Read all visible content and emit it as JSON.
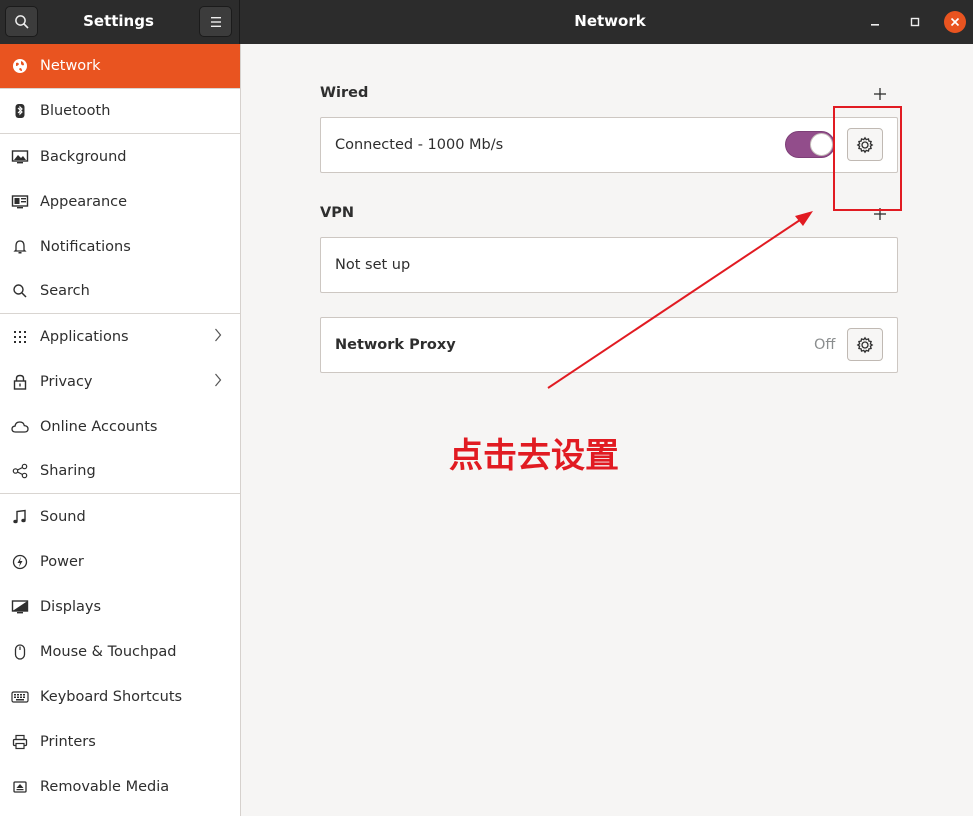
{
  "header": {
    "settings_title": "Settings",
    "page_title": "Network"
  },
  "sidebar": {
    "items": [
      {
        "label": "Network",
        "icon": "network-globe-icon"
      },
      {
        "label": "Bluetooth",
        "icon": "bluetooth-icon"
      },
      {
        "label": "Background",
        "icon": "background-monitor-icon"
      },
      {
        "label": "Appearance",
        "icon": "appearance-icon"
      },
      {
        "label": "Notifications",
        "icon": "bell-icon"
      },
      {
        "label": "Search",
        "icon": "search-icon"
      },
      {
        "label": "Applications",
        "icon": "grid-icon"
      },
      {
        "label": "Privacy",
        "icon": "lock-icon"
      },
      {
        "label": "Online Accounts",
        "icon": "cloud-icon"
      },
      {
        "label": "Sharing",
        "icon": "share-icon"
      },
      {
        "label": "Sound",
        "icon": "music-note-icon"
      },
      {
        "label": "Power",
        "icon": "power-icon"
      },
      {
        "label": "Displays",
        "icon": "display-icon"
      },
      {
        "label": "Mouse & Touchpad",
        "icon": "mouse-icon"
      },
      {
        "label": "Keyboard Shortcuts",
        "icon": "keyboard-icon"
      },
      {
        "label": "Printers",
        "icon": "printer-icon"
      },
      {
        "label": "Removable Media",
        "icon": "removable-media-icon"
      }
    ]
  },
  "wired": {
    "title": "Wired",
    "status": "Connected - 1000 Mb/s",
    "enabled": true
  },
  "vpn": {
    "title": "VPN",
    "status": "Not set up"
  },
  "proxy": {
    "label": "Network Proxy",
    "state": "Off"
  },
  "annotation": {
    "text": "点击去设置",
    "color": "#e11b22"
  },
  "colors": {
    "accent": "#e95420",
    "toggle_on": "#924d8b",
    "headerbar": "#2c2c2c"
  }
}
